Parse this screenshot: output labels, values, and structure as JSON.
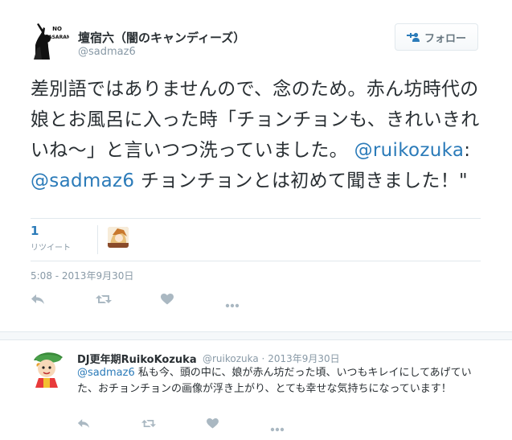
{
  "tweet": {
    "author_name": "壇宿六（闇のキャンディーズ）",
    "author_handle": "@sadmaz6",
    "avatar_text": "NO PASARAN",
    "follow_label": "フォロー",
    "text_part1": "差別語ではありませんので、念のため。赤ん坊時代の娘とお風呂に入った時「チョンチョンも、きれいきれいね～」と言いつつ洗っていました。",
    "mention1": "@ruikozuka",
    "text_sep": ": ",
    "mention2": "@sadmaz6",
    "text_part2": " チョンチョンとは初めて聞きました！\"",
    "retweet_count": "1",
    "retweet_label": "リツイート",
    "timestamp": "5:08 - 2013年9月30日"
  },
  "reply": {
    "author_name": "DJ更年期RuikoKozuka",
    "author_handle": "@ruikozuka",
    "date_sep": " · ",
    "date": "2013年9月30日",
    "mention": "@sadmaz6",
    "text": " 私も今、頭の中に、娘が赤ん坊だった頃、いつもキレイにしてあげていた、おチョンチョンの画像が浮き上がり、とても幸せな気持ちになっています！"
  },
  "icons": {
    "follow": "add-user-icon",
    "reply": "reply-icon",
    "retweet": "retweet-icon",
    "favorite": "heart-icon",
    "more": "more-icon"
  },
  "colors": {
    "link": "#2b7bb9",
    "muted": "#8899a6",
    "icon": "#aab8c2",
    "text": "#292f33"
  }
}
